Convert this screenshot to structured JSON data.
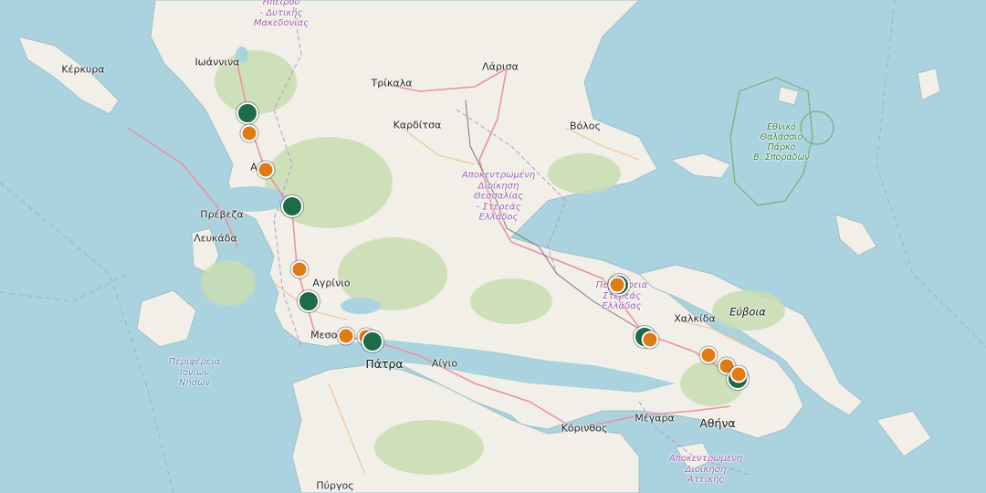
{
  "labels": {
    "kerkyra": "Κέρκυρα",
    "ioannina": "Ιωάννινα",
    "epirus": "Ηπείρου\n- Δυτικής\nΜακεδονίας",
    "larisa": "Λάρισα",
    "trikala": "Τρίκαλα",
    "karditsa": "Καρδίτσα",
    "volos": "Βόλος",
    "thessaly": "Αποκεντρωμένη\nΔιοίκηση\nΘεσσαλίας\n- Στερεάς\nΕλλάδος",
    "preveza": "Πρέβεζα",
    "lefkada": "Λευκάδα",
    "agrinio": "Αγρίνιο",
    "mesolongi": "Μεσολ",
    "patra": "Πάτρα",
    "aigio": "Αίγιο",
    "ionian": "Περιφέρεια\nΙονίων\nΝήσων",
    "sterea": "Περιφέρεια\nΣτερεάς\nΕλλάδας",
    "chalkida": "Χαλκίδα",
    "evia": "Εύβοια",
    "korinthos": "Κόρινθος",
    "megara": "Μέγαρα",
    "athina": "Αθήνα",
    "attica": "Αποκεντρωμένη\nΔιοίκηση\nΑττικής",
    "pyrgos": "Πύργος",
    "park": "Εθνικό\nΘαλάσσιο\nΠάρκο\nΒ. Σποράδων",
    "arta": "Α"
  },
  "colors": {
    "sea": "#aad3df",
    "land": "#f2efe9",
    "forest": "#c8ddb0",
    "marker_green": "#1e6b47",
    "marker_orange": "#e07b14",
    "region_text": "#9a5fa8",
    "park_border": "#6fb07a"
  },
  "markers": [
    {
      "name": "marker-green-ioannina-south",
      "color": "green"
    },
    {
      "name": "marker-orange-ioannina-south",
      "color": "orange"
    },
    {
      "name": "marker-orange-arta",
      "color": "orange"
    },
    {
      "name": "marker-green-amfilochia",
      "color": "green"
    },
    {
      "name": "marker-orange-astakos",
      "color": "orange"
    },
    {
      "name": "marker-green-aitoliko",
      "color": "green"
    },
    {
      "name": "marker-orange-mesolongi",
      "color": "orange"
    },
    {
      "name": "marker-orange-antirrio",
      "color": "orange"
    },
    {
      "name": "marker-green-antirrio",
      "color": "green"
    },
    {
      "name": "marker-green-lamia-east",
      "color": "green"
    },
    {
      "name": "marker-orange-lamia-east",
      "color": "orange"
    },
    {
      "name": "marker-green-thiva",
      "color": "green"
    },
    {
      "name": "marker-orange-thiva",
      "color": "orange"
    },
    {
      "name": "marker-orange-attica-north-1",
      "color": "orange"
    },
    {
      "name": "marker-orange-attica-north-2",
      "color": "orange"
    },
    {
      "name": "marker-green-attica-north",
      "color": "green"
    },
    {
      "name": "marker-orange-attica-north-3",
      "color": "orange"
    }
  ]
}
